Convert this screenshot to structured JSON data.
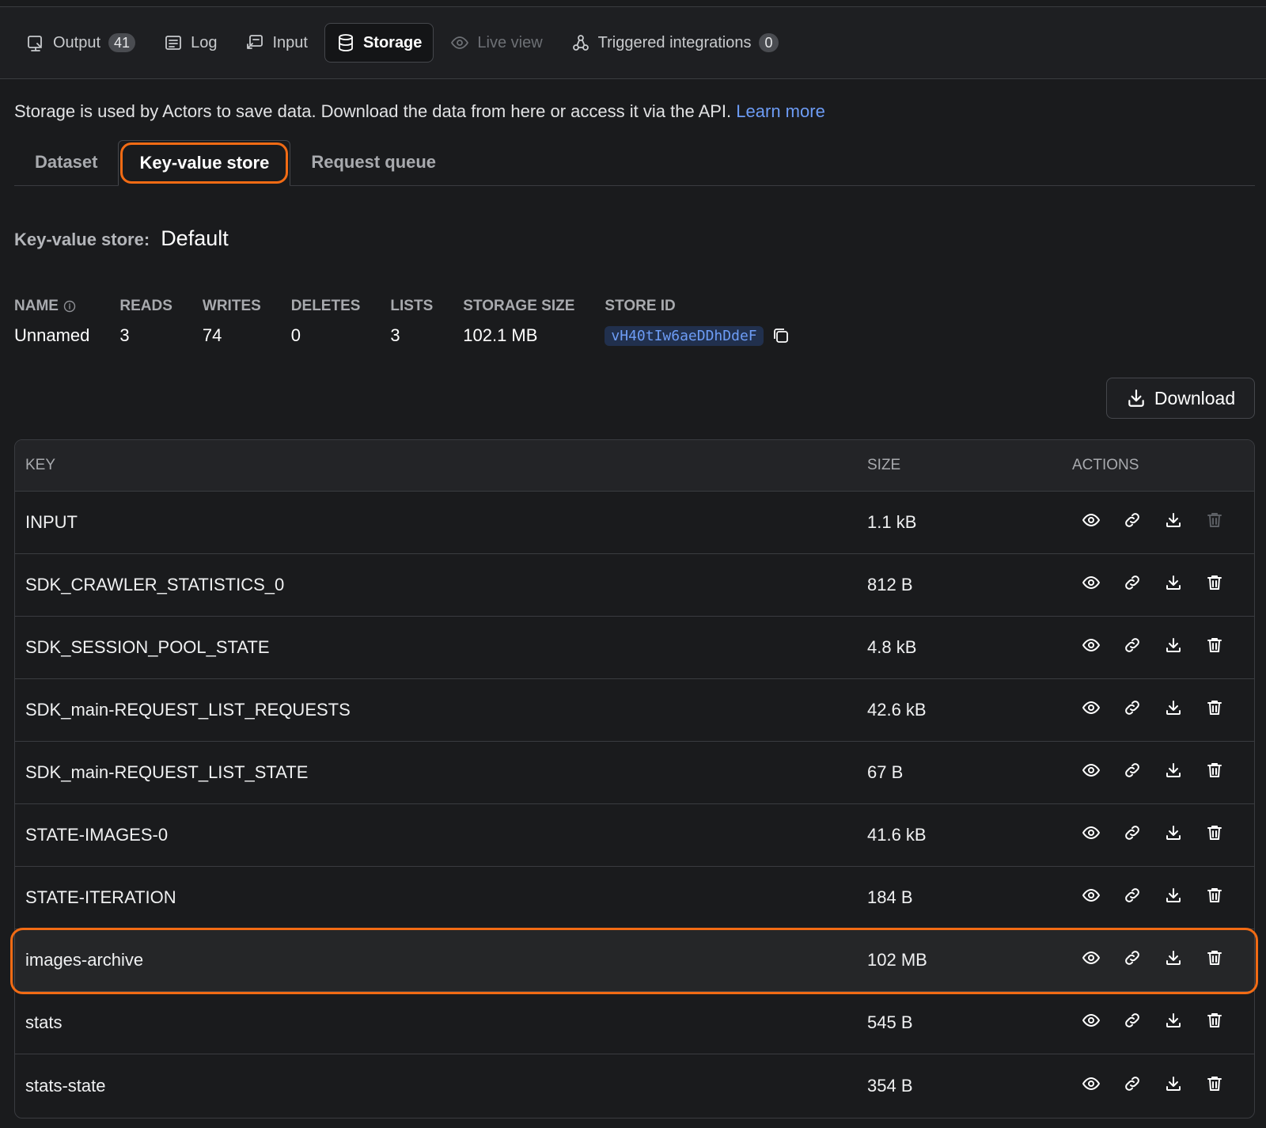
{
  "top_tabs": [
    {
      "label": "Output",
      "badge": "41",
      "icon": "output-icon",
      "state": "normal"
    },
    {
      "label": "Log",
      "icon": "log-icon",
      "state": "normal"
    },
    {
      "label": "Input",
      "icon": "input-icon",
      "state": "normal"
    },
    {
      "label": "Storage",
      "icon": "database-icon",
      "state": "active"
    },
    {
      "label": "Live view",
      "icon": "eye-scan-icon",
      "state": "disabled"
    },
    {
      "label": "Triggered integrations",
      "badge": "0",
      "icon": "integrations-icon",
      "state": "normal"
    }
  ],
  "description": {
    "text": "Storage is used by Actors to save data. Download the data from here or access it via the API.",
    "link": "Learn more"
  },
  "sub_tabs": [
    {
      "label": "Dataset",
      "active": false
    },
    {
      "label": "Key-value store",
      "active": true
    },
    {
      "label": "Request queue",
      "active": false
    }
  ],
  "store": {
    "label": "Key-value store:",
    "name": "Default"
  },
  "stats": {
    "name": {
      "header": "NAME",
      "value": "Unnamed"
    },
    "reads": {
      "header": "READS",
      "value": "3"
    },
    "writes": {
      "header": "WRITES",
      "value": "74"
    },
    "deletes": {
      "header": "DELETES",
      "value": "0"
    },
    "lists": {
      "header": "LISTS",
      "value": "3"
    },
    "size": {
      "header": "STORAGE SIZE",
      "value": "102.1 MB"
    },
    "id": {
      "header": "STORE ID",
      "value": "vH40tIw6aeDDhDdeF"
    }
  },
  "download_label": "Download",
  "table": {
    "columns": {
      "key": "KEY",
      "size": "SIZE",
      "actions": "ACTIONS"
    },
    "rows": [
      {
        "key": "INPUT",
        "size": "1.1 kB",
        "delete_enabled": false
      },
      {
        "key": "SDK_CRAWLER_STATISTICS_0",
        "size": "812 B",
        "delete_enabled": true
      },
      {
        "key": "SDK_SESSION_POOL_STATE",
        "size": "4.8 kB",
        "delete_enabled": true
      },
      {
        "key": "SDK_main-REQUEST_LIST_REQUESTS",
        "size": "42.6 kB",
        "delete_enabled": true
      },
      {
        "key": "SDK_main-REQUEST_LIST_STATE",
        "size": "67 B",
        "delete_enabled": true
      },
      {
        "key": "STATE-IMAGES-0",
        "size": "41.6 kB",
        "delete_enabled": true
      },
      {
        "key": "STATE-ITERATION",
        "size": "184 B",
        "delete_enabled": true
      },
      {
        "key": "images-archive",
        "size": "102 MB",
        "delete_enabled": true,
        "highlighted": true
      },
      {
        "key": "stats",
        "size": "545 B",
        "delete_enabled": true
      },
      {
        "key": "stats-state",
        "size": "354 B",
        "delete_enabled": true
      }
    ]
  },
  "colors": {
    "accent_highlight": "#f26b14",
    "link": "#6d9cf5",
    "background": "#1a1b1d"
  }
}
